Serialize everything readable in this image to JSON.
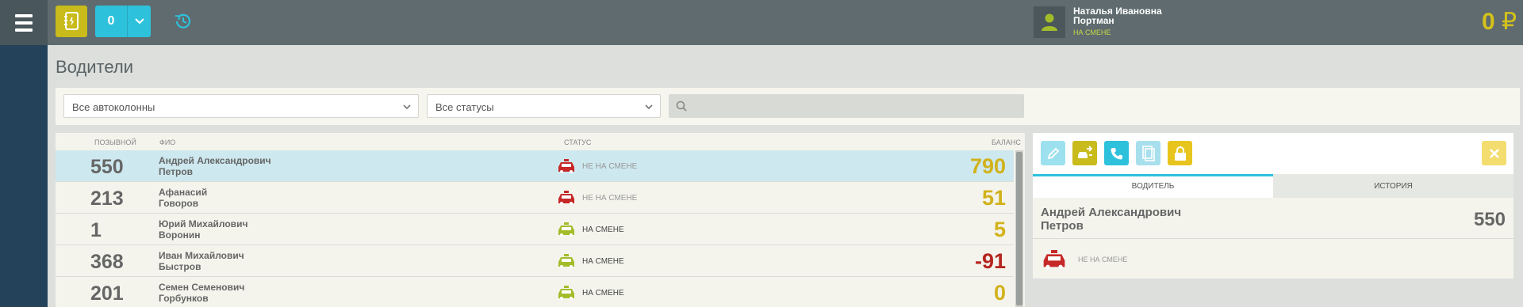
{
  "topbar": {
    "count_value": "0",
    "user": {
      "first_line": "Наталья Ивановна",
      "second_line": "Портман",
      "status": "НА СМЕНЕ"
    },
    "balance": "0",
    "currency": "₽"
  },
  "page": {
    "title": "Водители"
  },
  "filters": {
    "fleet": "Все автоколонны",
    "status": "Все статусы",
    "search_value": ""
  },
  "table": {
    "headers": {
      "callsign": "ПОЗЫВНОЙ",
      "fio": "ФИО",
      "status": "СТАТУС",
      "balance": "БАЛАНС"
    },
    "rows": [
      {
        "callsign": "550",
        "name": "Андрей Александрович",
        "surname": "Петров",
        "status": "НЕ НА СМЕНЕ",
        "balance": "790"
      },
      {
        "callsign": "213",
        "name": "Афанасий",
        "surname": "Говоров",
        "status": "НЕ НА СМЕНЕ",
        "balance": "51"
      },
      {
        "callsign": "1",
        "name": "Юрий Михайлович",
        "surname": "Воронин",
        "status": "НА СМЕНЕ",
        "balance": "5"
      },
      {
        "callsign": "368",
        "name": "Иван Михайлович",
        "surname": "Быстров",
        "status": "НА СМЕНЕ",
        "balance": "-91"
      },
      {
        "callsign": "201",
        "name": "Семен Семенович",
        "surname": "Горбунков",
        "status": "НА СМЕНЕ",
        "balance": "0"
      }
    ]
  },
  "detail": {
    "tabs": {
      "driver": "ВОДИТЕЛЬ",
      "history": "ИСТОРИЯ"
    },
    "name": "Андрей Александрович",
    "surname": "Петров",
    "callsign": "550",
    "status": "НЕ НА СМЕНЕ"
  },
  "colors": {
    "accent_yellow": "#c8bb1b",
    "accent_cyan": "#2ec1dc",
    "car_off": "#c62828",
    "car_on": "#a3bd2a",
    "balance_positive": "#d2b21c",
    "balance_negative": "#b5261e"
  },
  "icons": [
    "menu-icon",
    "phonebook-icon",
    "chevron-down-icon",
    "history-icon",
    "user-icon",
    "search-icon",
    "taxi-car-icon",
    "edit-icon",
    "transfer-icon",
    "phone-icon",
    "document-icon",
    "lock-icon",
    "close-icon"
  ]
}
